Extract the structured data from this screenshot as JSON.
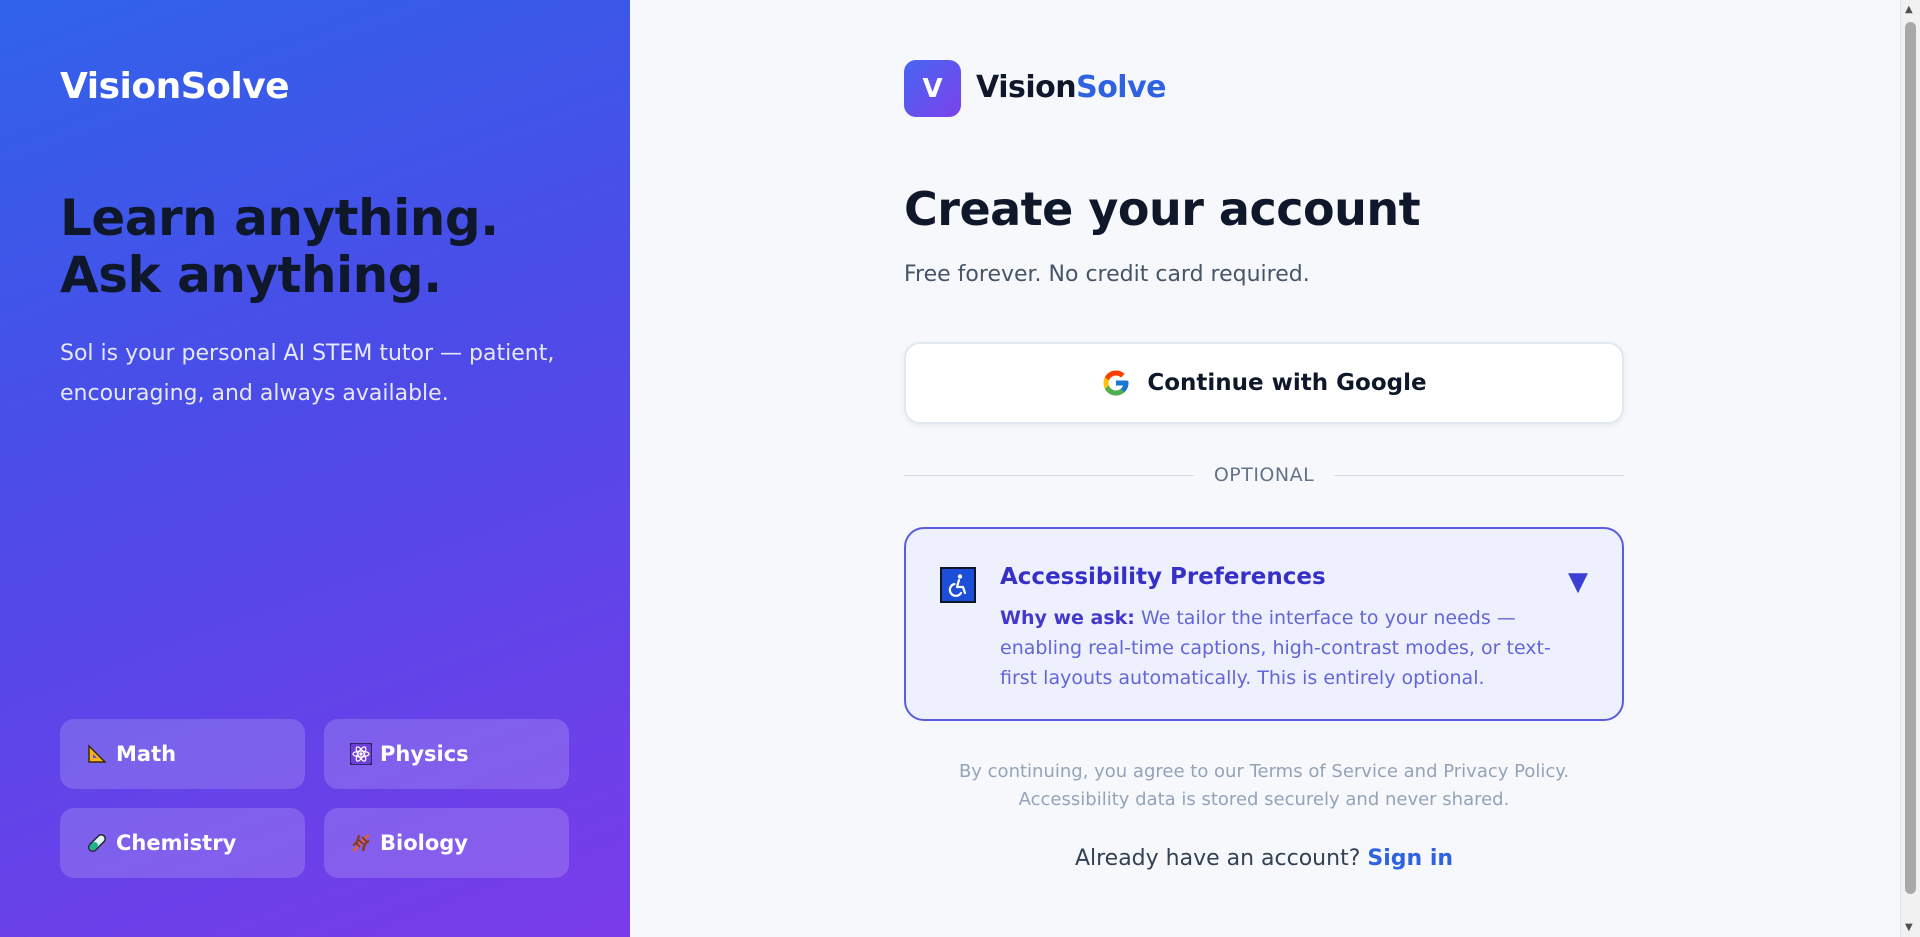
{
  "left_panel": {
    "brand": "VisionSolve",
    "headline": "Learn anything. Ask anything.",
    "description": "Sol is your personal AI STEM tutor — patient, encouraging, and always available.",
    "subjects": [
      {
        "label": "Math",
        "icon": "triangle-ruler-icon"
      },
      {
        "label": "Physics",
        "icon": "atom-icon"
      },
      {
        "label": "Chemistry",
        "icon": "test-tube-icon"
      },
      {
        "label": "Biology",
        "icon": "dna-icon"
      }
    ],
    "colors": {
      "gradient_start": "#3063ea",
      "gradient_end": "#7a3cea"
    }
  },
  "signup": {
    "logo_letter": "V",
    "brand_prefix": "Vision",
    "brand_suffix": "Solve",
    "title": "Create your account",
    "subtitle": "Free forever. No credit card required.",
    "google_button": "Continue with Google",
    "divider_text": "OPTIONAL",
    "accessibility": {
      "icon": "wheelchair-icon",
      "title": "Accessibility Preferences",
      "why_label": "Why we ask:",
      "why_text": " We tailor the interface to your needs — enabling real-time captions, high-contrast modes, or text-first layouts automatically. This is entirely optional.",
      "chevron": "▼"
    },
    "legal": "By continuing, you agree to our Terms of Service and Privacy Policy. Accessibility data is stored securely and never shared.",
    "signin_prompt": "Already have an account?",
    "signin_link": "Sign in",
    "colors": {
      "accent": "#2f62e0",
      "card_border": "#5b5ce6",
      "card_bg": "#eef1fd"
    }
  }
}
